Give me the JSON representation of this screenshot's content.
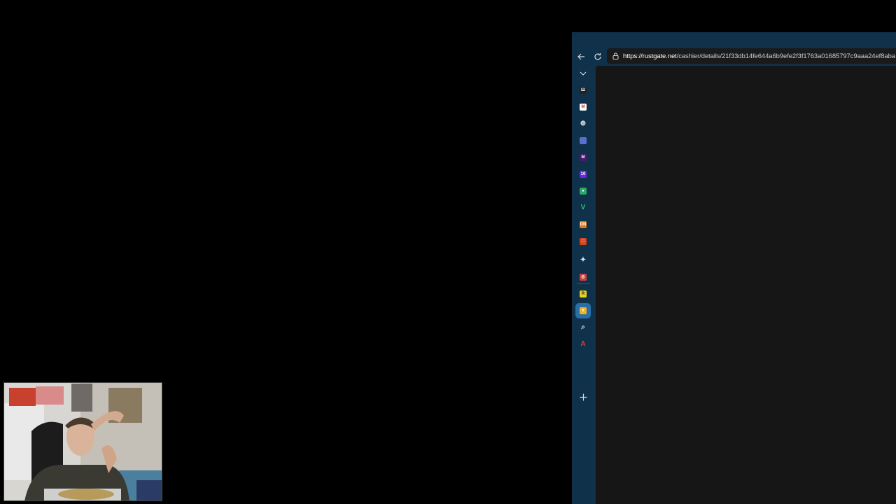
{
  "browser": {
    "address_bar": {
      "url_host": "https://rustgate.net",
      "url_path": "/cashier/details/21f33db14fe644a6b9efe2f3f1763a01685797c9aaa24ef8aba"
    },
    "toolbar": {
      "back_icon": "arrow-left-icon",
      "reload_icon": "reload-icon",
      "lock_icon": "lock-icon"
    },
    "sidebar": {
      "collapse_icon": "chevron-down-icon",
      "tabs": [
        {
          "name": "tab-1",
          "icon": "site-favicon",
          "color": "#222222",
          "glyph": "Ш"
        },
        {
          "name": "tab-gmail",
          "icon": "gmail-favicon",
          "color": "#ffffff",
          "glyph": "M"
        },
        {
          "name": "tab-3",
          "icon": "globe-icon",
          "color": "#0f3149",
          "glyph": "⊕"
        },
        {
          "name": "tab-4",
          "icon": "flag-favicon",
          "color": "#5a6fd0",
          "glyph": ""
        },
        {
          "name": "tab-5",
          "icon": "site-favicon",
          "color": "#4a1a6e",
          "glyph": "M"
        },
        {
          "name": "tab-6",
          "icon": "site-favicon",
          "color": "#6a2be0",
          "glyph": "10"
        },
        {
          "name": "tab-7",
          "icon": "site-favicon",
          "color": "#2aa86a",
          "glyph": "●"
        },
        {
          "name": "tab-8",
          "icon": "vue-favicon",
          "color": "#41b883",
          "glyph": "V"
        },
        {
          "name": "tab-9",
          "icon": "site-favicon",
          "color": "#e07a20",
          "glyph": "DN"
        },
        {
          "name": "tab-10",
          "icon": "site-favicon",
          "color": "#d9441c",
          "glyph": "□"
        },
        {
          "name": "tab-11",
          "icon": "sparkle-icon",
          "color": "#0f3149",
          "glyph": "✦"
        },
        {
          "name": "tab-12",
          "icon": "site-favicon",
          "color": "#d04040",
          "glyph": "◎"
        },
        {
          "name": "tab-13",
          "icon": "site-favicon",
          "color": "#e8d21a",
          "glyph": "R"
        },
        {
          "name": "tab-14-active",
          "icon": "site-favicon",
          "color": "#f0b429",
          "glyph": "▼"
        },
        {
          "name": "tab-15",
          "icon": "search-icon",
          "color": "#0f3149",
          "glyph": "⌕"
        },
        {
          "name": "tab-16",
          "icon": "site-favicon",
          "color": "#0f3149",
          "glyph": "A"
        }
      ],
      "new_tab_icon": "plus-icon"
    }
  },
  "webcam": {
    "description_icon": "webcam-feed"
  }
}
